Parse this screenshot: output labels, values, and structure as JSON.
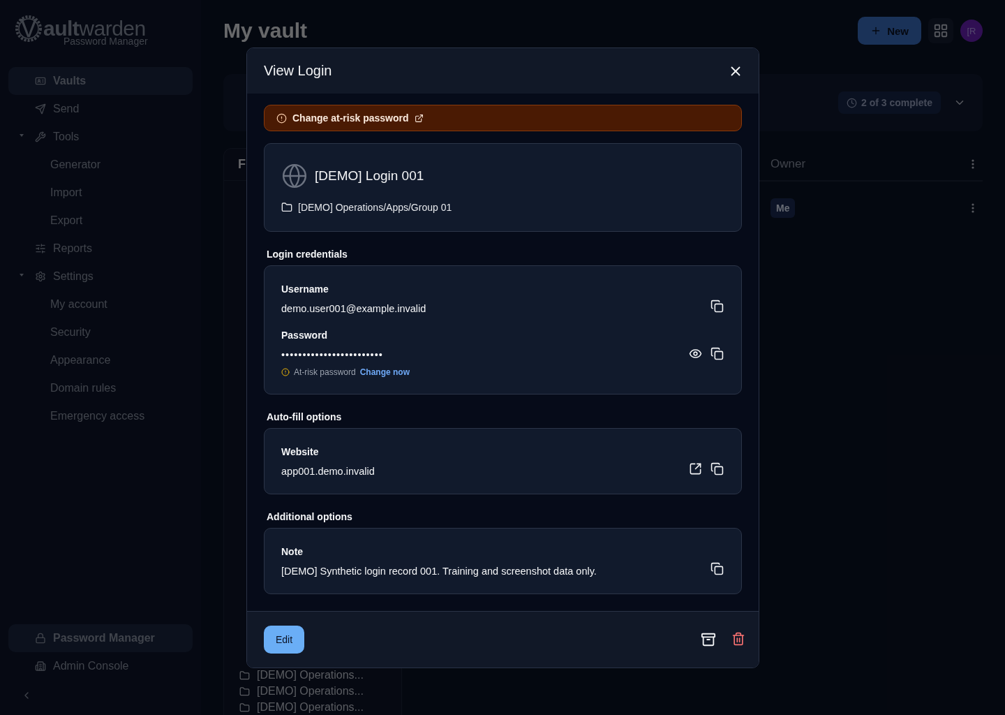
{
  "sidebar": {
    "logo": {
      "lead": "V",
      "bold": "ault",
      "light": "warden",
      "subtitle": "Password Manager"
    },
    "nav": [
      {
        "kind": "item",
        "label": "Vaults",
        "selected": true
      },
      {
        "kind": "item",
        "label": "Send",
        "selected": false
      },
      {
        "kind": "group",
        "label": "Tools",
        "expanded": true,
        "children": [
          {
            "label": "Generator",
            "selected": false
          },
          {
            "label": "Import",
            "selected": false
          },
          {
            "label": "Export",
            "selected": false
          }
        ]
      },
      {
        "kind": "item",
        "label": "Reports",
        "selected": false
      },
      {
        "kind": "group",
        "label": "Settings",
        "expanded": true,
        "children": [
          {
            "label": "My account",
            "selected": false
          },
          {
            "label": "Security",
            "selected": false
          },
          {
            "label": "Appearance",
            "selected": false
          },
          {
            "label": "Domain rules",
            "selected": false
          },
          {
            "label": "Emergency access",
            "selected": false
          }
        ]
      }
    ],
    "products": [
      {
        "label": "Password Manager",
        "selected": true
      },
      {
        "label": "Admin Console",
        "selected": false
      }
    ]
  },
  "header": {
    "title": "My vault",
    "new_button": "New",
    "avatar": "[R"
  },
  "banner": {
    "progress": "2 of 3 complete"
  },
  "filters": {
    "heading": "F",
    "folders": [
      "[DEMO] Operations...",
      "[DEMO] Operations...",
      "[DEMO] Operations..."
    ]
  },
  "table": {
    "columns": [
      "Owner"
    ],
    "rows": [
      {
        "owner": "Me"
      }
    ]
  },
  "dialog": {
    "title": "View Login",
    "alert": {
      "text": "Change at-risk password"
    },
    "item": {
      "name": "[DEMO] Login 001",
      "folder": "[DEMO] Operations/Apps/Group 01"
    },
    "sections": [
      {
        "heading": "Login credentials",
        "fields": [
          {
            "kind": "username",
            "label": "Username",
            "value": "demo.user001@example.invalid"
          },
          {
            "kind": "password",
            "label": "Password",
            "value": "••••••••••••••••••••••••",
            "risk": {
              "text": "At-risk password",
              "link": "Change now"
            }
          }
        ]
      },
      {
        "heading": "Auto-fill options",
        "fields": [
          {
            "kind": "website",
            "label": "Website",
            "value": "app001.demo.invalid"
          }
        ]
      },
      {
        "heading": "Additional options",
        "fields": [
          {
            "kind": "note",
            "label": "Note",
            "value": "[DEMO] Synthetic login record 001. Training and screenshot data only."
          }
        ]
      }
    ],
    "edit_button": "Edit"
  }
}
